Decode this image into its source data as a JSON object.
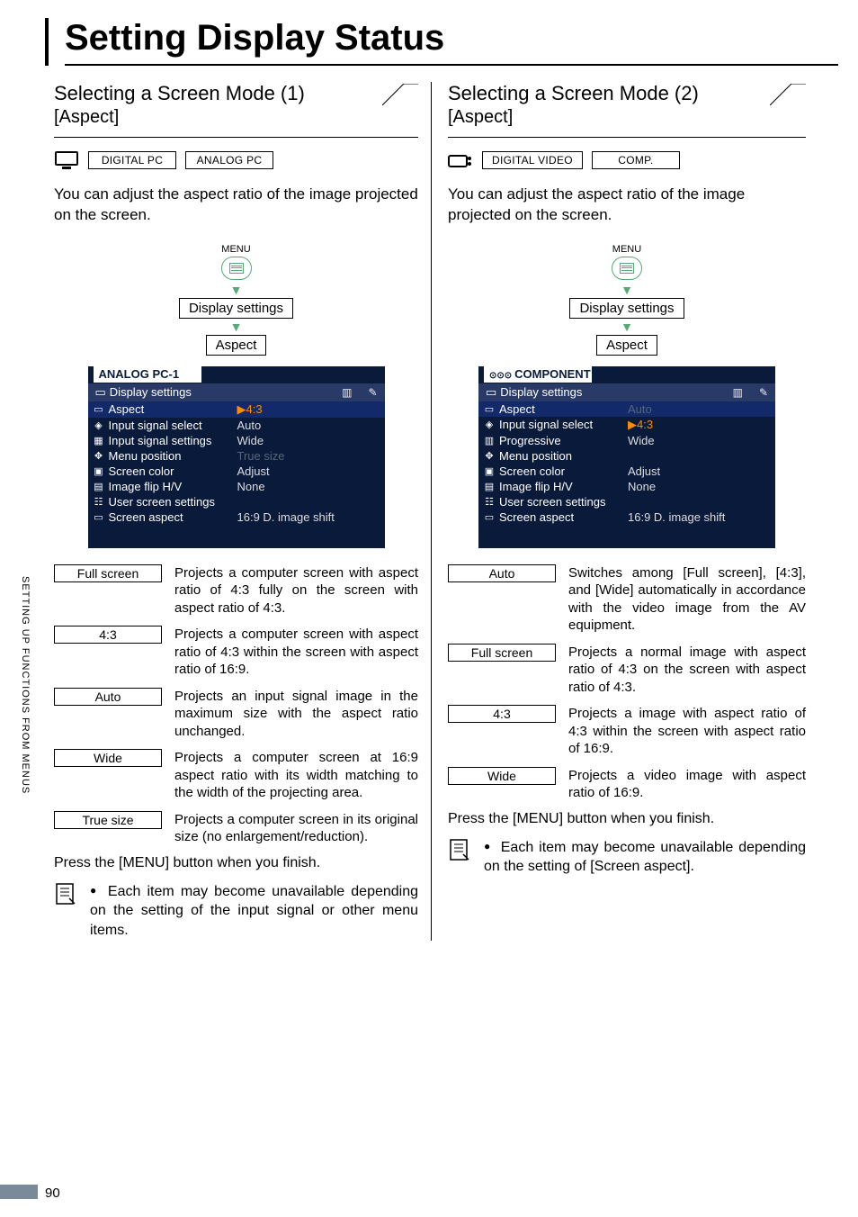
{
  "page_title": "Setting Display Status",
  "side_tab": "SETTING UP FUNCTIONS FROM MENUS",
  "page_number": "90",
  "left": {
    "heading": "Selecting a Screen Mode (1)",
    "label": "[Aspect]",
    "modes": [
      "DIGITAL PC",
      "ANALOG PC"
    ],
    "intro": "You can adjust the aspect ratio of the image projected on the screen.",
    "flow": {
      "menu": "MENU",
      "step1": "Display settings",
      "step2": "Aspect"
    },
    "osd": {
      "title": "ANALOG PC-1",
      "subtitle": "Display settings",
      "rows": [
        {
          "k": "Aspect",
          "v": "4:3",
          "vmode": "sel",
          "sel": true,
          "icon": "▭",
          "marker": "▶"
        },
        {
          "k": "Input signal select",
          "v": "Auto",
          "icon": "◈"
        },
        {
          "k": "Input signal settings",
          "v": "Wide",
          "icon": "▦"
        },
        {
          "k": "Menu position",
          "v": "True size",
          "vmode": "dim",
          "icon": "✥"
        },
        {
          "k": "Screen color",
          "v": "Adjust",
          "icon": "▣"
        },
        {
          "k": "Image flip H/V",
          "v": "None",
          "icon": "▤"
        },
        {
          "k": "User screen settings",
          "v": "",
          "icon": "☷"
        },
        {
          "k": "Screen aspect",
          "v": "16:9 D. image shift",
          "icon": "▭"
        }
      ]
    },
    "options": [
      {
        "tag": "Full screen",
        "desc": "Projects a computer screen with aspect ratio of 4:3 fully on the screen with aspect ratio of 4:3."
      },
      {
        "tag": "4:3",
        "desc": "Projects a computer screen with aspect ratio of 4:3 within the screen with aspect ratio of 16:9."
      },
      {
        "tag": "Auto",
        "desc": "Projects an input signal image in the maximum size with the aspect ratio unchanged."
      },
      {
        "tag": "Wide",
        "desc": "Projects a computer screen at 16:9 aspect ratio with its width matching to the width of the projecting area."
      },
      {
        "tag": "True size",
        "desc": "Projects a computer screen in its original size (no enlargement/reduction)."
      }
    ],
    "footer": "Press the [MENU] button when you finish.",
    "note": "Each item may become unavailable depending on the setting of the input signal or other menu items."
  },
  "right": {
    "heading": "Selecting a Screen Mode (2)",
    "label": "[Aspect]",
    "modes": [
      "DIGITAL VIDEO",
      "COMP."
    ],
    "intro": "You can adjust the aspect ratio of the image projected on the screen.",
    "flow": {
      "menu": "MENU",
      "step1": "Display settings",
      "step2": "Aspect"
    },
    "osd": {
      "title": "COMPONENT",
      "subtitle": "Display settings",
      "rows": [
        {
          "k": "Aspect",
          "v": "Auto",
          "vmode": "dim",
          "sel": true,
          "icon": "▭"
        },
        {
          "k": "Input signal select",
          "v": "4:3",
          "vmode": "sel",
          "icon": "◈",
          "marker": "▶"
        },
        {
          "k": "Progressive",
          "v": "Wide",
          "icon": "▥"
        },
        {
          "k": "Menu position",
          "v": "",
          "icon": "✥"
        },
        {
          "k": "Screen color",
          "v": "Adjust",
          "icon": "▣"
        },
        {
          "k": "Image flip H/V",
          "v": "None",
          "icon": "▤"
        },
        {
          "k": "User screen settings",
          "v": "",
          "icon": "☷"
        },
        {
          "k": "Screen aspect",
          "v": "16:9 D. image shift",
          "icon": "▭"
        }
      ]
    },
    "options": [
      {
        "tag": "Auto",
        "desc": "Switches among [Full screen], [4:3], and [Wide] automatically in accordance with the video image from the AV equipment."
      },
      {
        "tag": "Full screen",
        "desc": "Projects a normal image with aspect ratio of 4:3 on the screen with aspect ratio of 4:3."
      },
      {
        "tag": "4:3",
        "desc": "Projects a image with aspect ratio of 4:3 within the screen with aspect ratio of 16:9."
      },
      {
        "tag": "Wide",
        "desc": "Projects a video image with aspect ratio of 16:9."
      }
    ],
    "footer": "Press the [MENU] button when you finish.",
    "note": "Each item may become unavailable depending on the setting of [Screen aspect]."
  }
}
